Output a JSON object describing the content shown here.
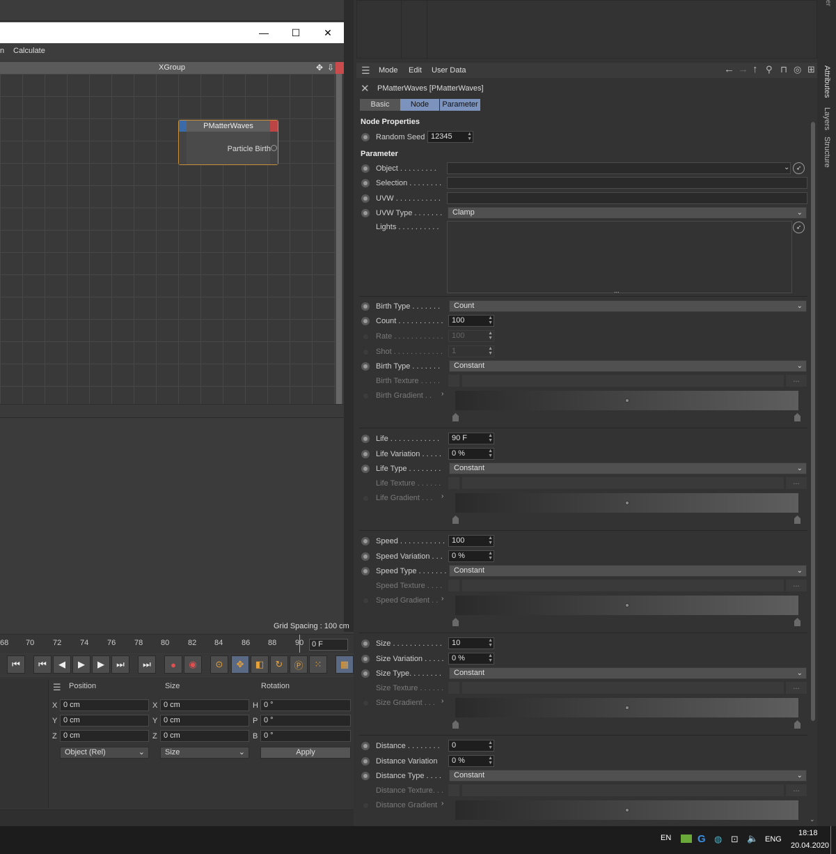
{
  "xpresso": {
    "menu": [
      "n",
      "Calculate"
    ],
    "group_title": "XGroup",
    "node": {
      "title": "PMatterWaves",
      "port": "Particle Birth"
    },
    "grid_spacing": "Grid Spacing : 100 cm"
  },
  "timeline": {
    "ticks": [
      "68",
      "70",
      "72",
      "74",
      "76",
      "78",
      "80",
      "82",
      "84",
      "86",
      "88",
      "90"
    ],
    "frame": "0 F"
  },
  "coordinates": {
    "headers": {
      "position": "Position",
      "size": "Size",
      "rotation": "Rotation"
    },
    "rows": [
      {
        "axis": "X",
        "pos": "0 cm",
        "size_axis": "X",
        "size": "0 cm",
        "rot_axis": "H",
        "rot": "0 °"
      },
      {
        "axis": "Y",
        "pos": "0 cm",
        "size_axis": "Y",
        "size": "0 cm",
        "rot_axis": "P",
        "rot": "0 °"
      },
      {
        "axis": "Z",
        "pos": "0 cm",
        "size_axis": "Z",
        "size": "0 cm",
        "rot_axis": "B",
        "rot": "0 °"
      }
    ],
    "mode_select": "Object (Rel)",
    "size_select": "Size",
    "apply": "Apply"
  },
  "attributes": {
    "menu": {
      "mode": "Mode",
      "edit": "Edit",
      "user_data": "User Data"
    },
    "object_name": "PMatterWaves [PMatterWaves]",
    "tabs": {
      "basic": "Basic",
      "node": "Node",
      "parameter": "Parameter"
    },
    "sections": {
      "node_properties": "Node Properties",
      "parameter": "Parameter"
    },
    "random_seed": {
      "label": "Random Seed",
      "value": "12345"
    },
    "object": {
      "label": "Object . . . . . . . . ."
    },
    "selection": {
      "label": "Selection . . . . . . . ."
    },
    "uvw": {
      "label": "UVW . . . . . . . . . . ."
    },
    "uvw_type": {
      "label": "UVW Type . . . . . . .",
      "value": "Clamp"
    },
    "lights": {
      "label": "Lights . . . . . . . . . ."
    },
    "birth_type": {
      "label": "Birth Type . . . . . . .",
      "value": "Count"
    },
    "count": {
      "label": "Count . . . . . . . . . . .",
      "value": "100"
    },
    "rate": {
      "label": "Rate . . . . . . . . . . . .",
      "value": "100"
    },
    "shot": {
      "label": "Shot . . . . . . . . . . . .",
      "value": "1"
    },
    "birth_type2": {
      "label": "Birth Type . . . . . . .",
      "value": "Constant"
    },
    "birth_texture": {
      "label": "Birth Texture . . . . ."
    },
    "birth_gradient": {
      "label": "Birth Gradient . ."
    },
    "life": {
      "label": "Life . . . . . . . . . . . .",
      "value": "90 F"
    },
    "life_variation": {
      "label": "Life Variation . . . . .",
      "value": "0 %"
    },
    "life_type": {
      "label": "Life Type . . . . . . . .",
      "value": "Constant"
    },
    "life_texture": {
      "label": "Life Texture . . . . . ."
    },
    "life_gradient": {
      "label": "Life Gradient . . ."
    },
    "speed": {
      "label": "Speed . . . . . . . . . . .",
      "value": "100"
    },
    "speed_variation": {
      "label": "Speed Variation . . .",
      "value": "0 %"
    },
    "speed_type": {
      "label": "Speed Type . . . . . . .",
      "value": "Constant"
    },
    "speed_texture": {
      "label": "Speed Texture . . . ."
    },
    "speed_gradient": {
      "label": "Speed Gradient . ."
    },
    "size": {
      "label": "Size . . . . . . . . . . . .",
      "value": "10"
    },
    "size_variation": {
      "label": "Size Variation . . . . .",
      "value": "0 %"
    },
    "size_type": {
      "label": "Size Type. . . . . . . .",
      "value": "Constant"
    },
    "size_texture": {
      "label": "Size Texture . . . . . ."
    },
    "size_gradient": {
      "label": "Size Gradient . . ."
    },
    "distance": {
      "label": "Distance . . . . . . . .",
      "value": "0"
    },
    "distance_variation": {
      "label": "Distance Variation",
      "value": "0 %"
    },
    "distance_type": {
      "label": "Distance Type . . . .",
      "value": "Constant"
    },
    "distance_texture": {
      "label": "Distance Texture. . ."
    },
    "distance_gradient": {
      "label": "Distance Gradient"
    },
    "dots": "...",
    "side_tabs": [
      "Attributes",
      "Layers",
      "Structure"
    ],
    "top_edge_text": "er"
  },
  "taskbar": {
    "lang1": "EN",
    "lang2": "ENG",
    "time": "18:18",
    "date": "20.04.2020"
  },
  "colors": {
    "accent_tab": "#7c93bd",
    "node_border": "#c9903c",
    "node_port_left": "#3b6aa8",
    "node_port_right": "#bb4444"
  }
}
